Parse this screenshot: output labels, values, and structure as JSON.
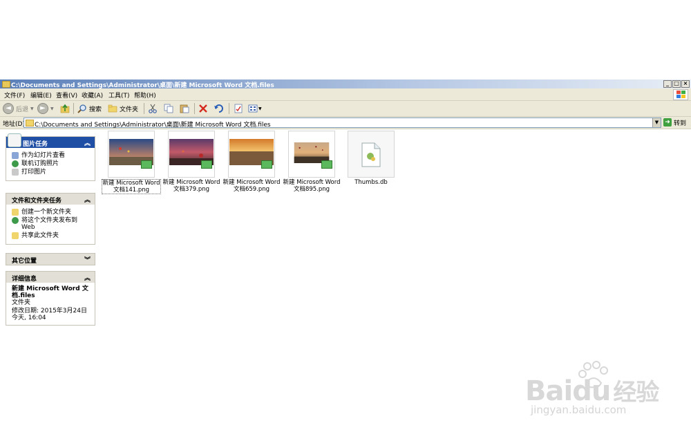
{
  "window": {
    "title": "C:\\Documents and Settings\\Administrator\\桌面\\新建 Microsoft Word 文档.files",
    "controls": [
      "_",
      "□",
      "×"
    ]
  },
  "menu": [
    "文件(F)",
    "编辑(E)",
    "查看(V)",
    "收藏(A)",
    "工具(T)",
    "帮助(H)"
  ],
  "toolbar": {
    "back_label": "后退",
    "search_label": "搜索",
    "folders_label": "文件夹"
  },
  "address": {
    "label": "地址(D)",
    "value": "C:\\Documents and Settings\\Administrator\\桌面\\新建 Microsoft Word 文档.files",
    "go_label": "转到"
  },
  "panels": {
    "picture_tasks": {
      "title": "图片任务",
      "items": [
        "作为幻灯片查看",
        "联机订购照片",
        "打印图片"
      ]
    },
    "file_tasks": {
      "title": "文件和文件夹任务",
      "items": [
        "创建一个新文件夹",
        "将这个文件夹发布到 Web",
        "共享此文件夹"
      ]
    },
    "other_places": {
      "title": "其它位置"
    },
    "details": {
      "title": "详细信息",
      "name": "新建 Microsoft Word 文档.files",
      "type": "文件夹",
      "modified": "修改日期: 2015年3月24日 今天, 16:04"
    }
  },
  "files": [
    {
      "name": "新建 Microsoft Word 文档141.png",
      "kind": "image",
      "selected": true
    },
    {
      "name": "新建 Microsoft Word 文档379.png",
      "kind": "image"
    },
    {
      "name": "新建 Microsoft Word 文档659.png",
      "kind": "image"
    },
    {
      "name": "新建 Microsoft Word 文档895.png",
      "kind": "image"
    },
    {
      "name": "Thumbs.db",
      "kind": "db"
    }
  ],
  "watermark": {
    "brand": "Baidu",
    "cn": "经验",
    "url": "jingyan.baidu.com"
  },
  "colors": {
    "titlebar": "#5a7fb8",
    "taskpane_head": "#1f4fa4",
    "chrome": "#ece9d8"
  }
}
